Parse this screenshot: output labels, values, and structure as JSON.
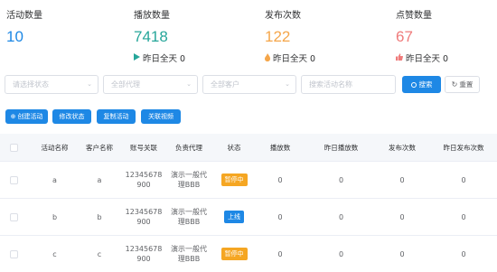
{
  "stats": [
    {
      "label": "活动数量",
      "value": "10",
      "color": "#1e88e5",
      "sub": ""
    },
    {
      "label": "播放数量",
      "value": "7418",
      "color": "#26a69a",
      "sub": "昨日全天 0",
      "sub_icon": "play-icon",
      "sub_color": "#26a69a"
    },
    {
      "label": "发布次数",
      "value": "122",
      "color": "#f5a64a",
      "sub": "昨日全天 0",
      "sub_icon": "flame-icon",
      "sub_color": "#f5a64a"
    },
    {
      "label": "点赞数量",
      "value": "67",
      "color": "#ef7b7b",
      "sub": "昨日全天 0",
      "sub_icon": "thumb-icon",
      "sub_color": "#ef7b7b"
    }
  ],
  "filters": {
    "status_placeholder": "请选择状态",
    "agent_placeholder": "全部代理",
    "customer_placeholder": "全部客户",
    "search_placeholder": "搜索活动名称",
    "search_label": "搜索",
    "reset_label": "重置"
  },
  "actions": {
    "create": "创建活动",
    "edit_status": "修改状态",
    "copy": "复制活动",
    "link_video": "关联视频"
  },
  "table": {
    "headers": [
      "活动名称",
      "客户名称",
      "账号关联",
      "负责代理",
      "状态",
      "播放数",
      "昨日播放数",
      "发布次数",
      "昨日发布次数"
    ],
    "rows": [
      {
        "name": "a",
        "customer": "a",
        "account": "12345678\n900",
        "agent": "演示一般代\n理BBB",
        "status": "暂停中",
        "status_color": "#f5a623",
        "plays": "0",
        "y_plays": "0",
        "publishes": "0",
        "y_publishes": "0"
      },
      {
        "name": "b",
        "customer": "b",
        "account": "12345678\n900",
        "agent": "演示一般代\n理BBB",
        "status": "上线",
        "status_color": "#1e88e5",
        "plays": "0",
        "y_plays": "0",
        "publishes": "0",
        "y_publishes": "0"
      },
      {
        "name": "c",
        "customer": "c",
        "account": "12345678\n900",
        "agent": "演示一般代\n理BBB",
        "status": "暂停中",
        "status_color": "#f5a623",
        "plays": "0",
        "y_plays": "0",
        "publishes": "0",
        "y_publishes": "0"
      }
    ]
  }
}
